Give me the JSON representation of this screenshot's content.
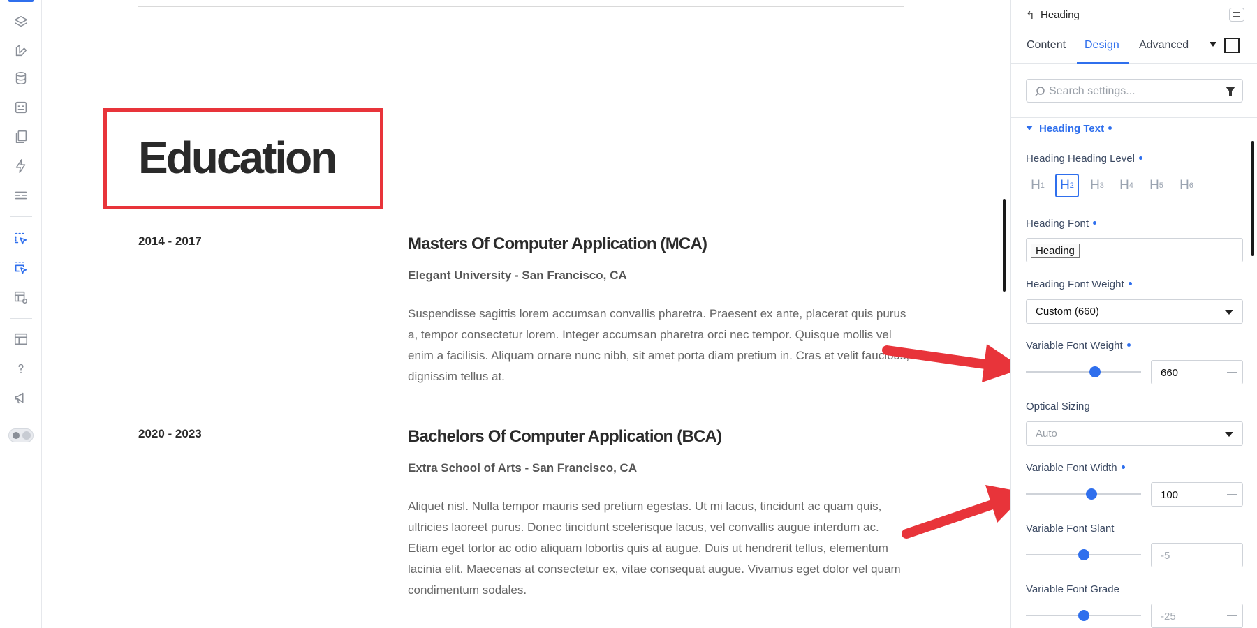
{
  "canvas": {
    "section_title": "Education",
    "entries": [
      {
        "years": "2014 - 2017",
        "degree": "Masters Of Computer Application (MCA)",
        "school": "Elegant University - San Francisco, CA",
        "description": "Suspendisse sagittis lorem accumsan convallis pharetra. Praesent ex ante, placerat quis purus a, tempor consectetur lorem. Integer accumsan pharetra orci nec tempor. Quisque mollis vel enim a facilisis. Aliquam ornare nunc nibh, sit amet porta diam pretium in. Cras et velit faucibus, dignissim tellus at."
      },
      {
        "years": "2020 - 2023",
        "degree": "Bachelors Of Computer Application (BCA)",
        "school": "Extra School of Arts - San Francisco, CA",
        "description": "Aliquet nisl. Nulla tempor mauris sed pretium egestas. Ut mi lacus, tincidunt ac quam quis, ultricies laoreet purus. Donec tincidunt scelerisque lacus, vel convallis augue interdum ac. Etiam eget tortor ac odio aliquam lobortis quis at augue. Duis ut hendrerit tellus, elementum lacinia elit. Maecenas at consectetur ex, vitae consequat augue. Vivamus eget dolor vel quam condimentum sodales."
      }
    ]
  },
  "panel": {
    "back_icon": "↰",
    "element_title": "Heading",
    "tabs": [
      "Content",
      "Design",
      "Advanced"
    ],
    "active_tab": "Design",
    "search": {
      "placeholder": "Search settings...",
      "value": ""
    },
    "section_title": "Heading Text",
    "heading_level": {
      "label": "Heading Heading Level",
      "levels": [
        {
          "h": "H",
          "n": "1"
        },
        {
          "h": "H",
          "n": "2"
        },
        {
          "h": "H",
          "n": "3"
        },
        {
          "h": "H",
          "n": "4"
        },
        {
          "h": "H",
          "n": "5"
        },
        {
          "h": "H",
          "n": "6"
        }
      ],
      "selected": "H2"
    },
    "heading_font": {
      "label": "Heading Font",
      "value": "Heading"
    },
    "font_weight": {
      "label": "Heading Font Weight",
      "value": "Custom (660)"
    },
    "variable_weight": {
      "label": "Variable Font Weight",
      "value": "660",
      "level": 0.6
    },
    "optical_sizing": {
      "label": "Optical Sizing",
      "value": "Auto"
    },
    "variable_width": {
      "label": "Variable Font Width",
      "value": "100",
      "level": 0.57
    },
    "variable_slant": {
      "label": "Variable Font Slant",
      "value": "-5",
      "level": 0.5
    },
    "variable_grade": {
      "label": "Variable Font Grade",
      "value": "-25",
      "level": 0.5
    }
  },
  "colors": {
    "accent": "#2f6fed",
    "annotation_red": "#e8343a"
  },
  "icons": {
    "rail": [
      "layers-icon",
      "palette-icon",
      "database-icon",
      "forms-icon",
      "pages-icon",
      "lightning-icon",
      "sliders-icon",
      "click-select-icon",
      "multi-select-icon",
      "preview-icon",
      "templates-icon",
      "help-icon",
      "megaphone-icon",
      "theme-toggle-icon"
    ]
  }
}
